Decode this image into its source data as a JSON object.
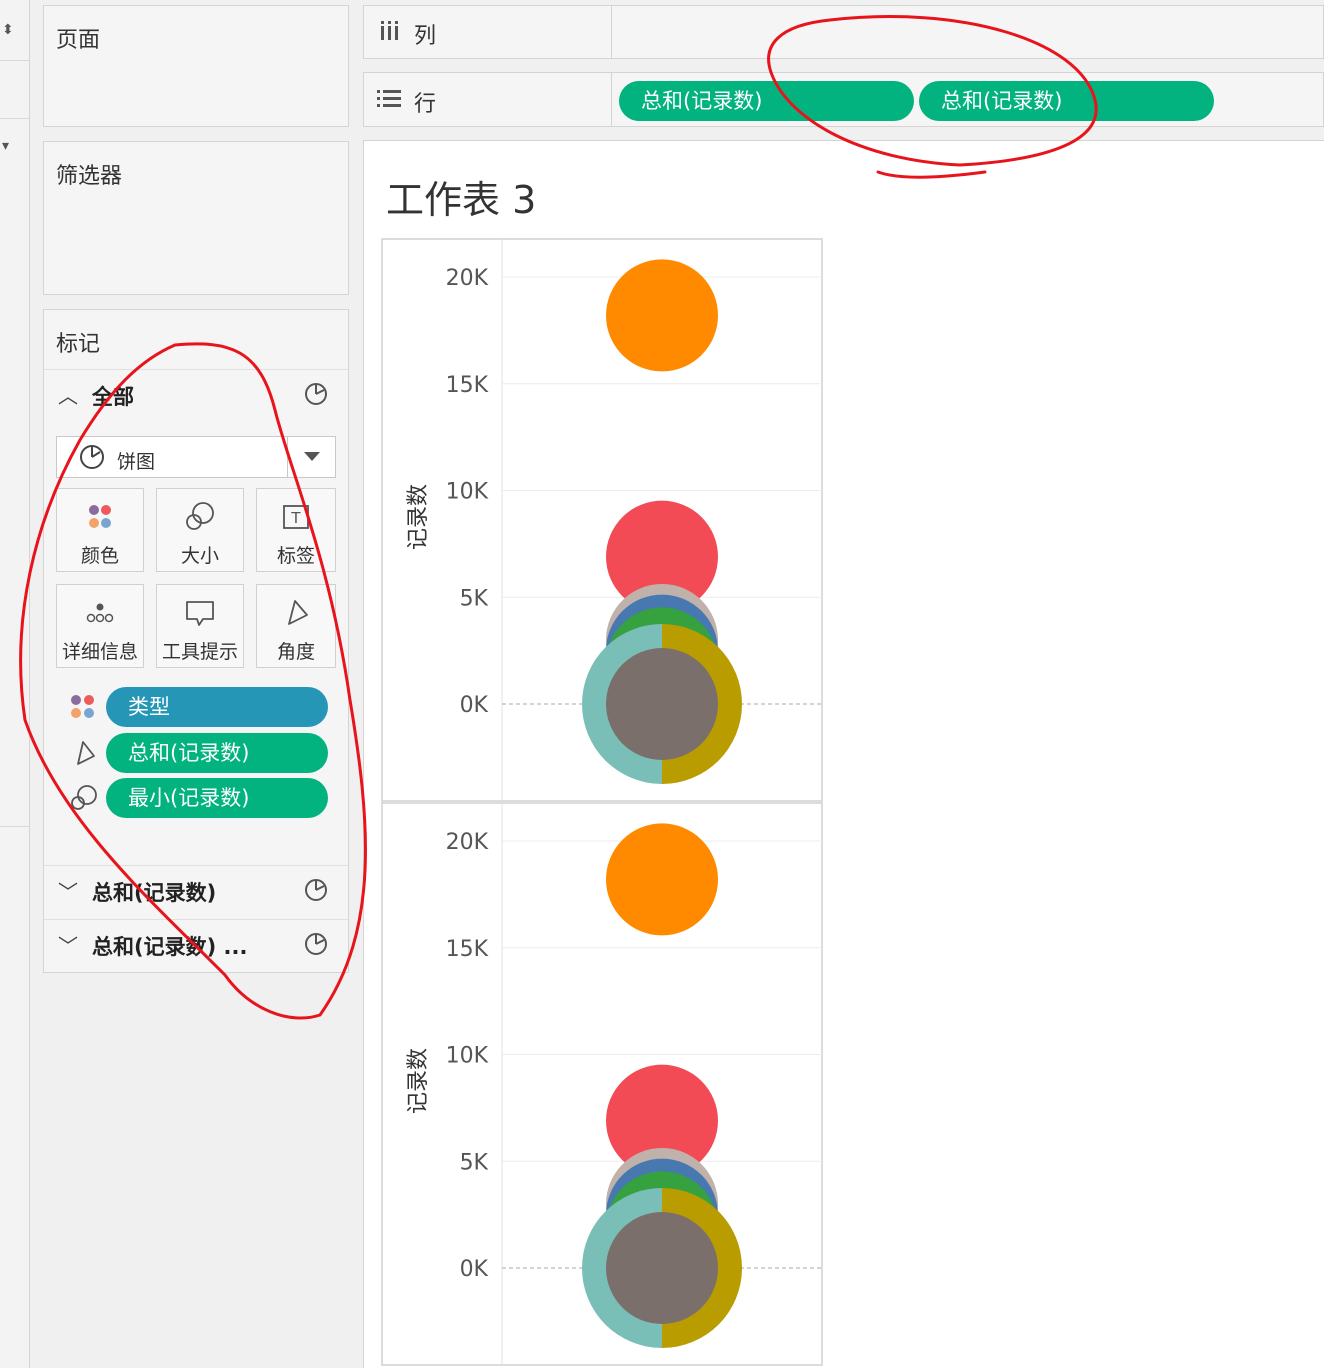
{
  "panels": {
    "pages_title": "页面",
    "filters_title": "筛选器",
    "marks_title": "标记"
  },
  "shelves": {
    "columns_label": "列",
    "rows_label": "行",
    "row_pills": [
      "总和(记录数)",
      "总和(记录数)"
    ]
  },
  "marks": {
    "all_label": "全部",
    "mark_type": "饼图",
    "buttons": [
      "颜色",
      "大小",
      "标签",
      "详细信息",
      "工具提示",
      "角度"
    ],
    "fields": [
      "类型",
      "总和(记录数)",
      "最小(记录数)"
    ],
    "sub_rows": [
      "总和(记录数)",
      "总和(记录数) ..."
    ]
  },
  "sheet": {
    "title": "工作表 3"
  },
  "colors": {
    "green_pill": "#02b37f",
    "blue_pill": "#2596b5",
    "annotation": "#e8141c"
  },
  "chart_data": [
    {
      "type": "scatter",
      "ylabel": "记录数",
      "xlabel": "",
      "ylim": [
        -3000,
        21000
      ],
      "ytick_labels": [
        "20K",
        "15K",
        "10K",
        "5K",
        "0K"
      ],
      "yticks": [
        20000,
        15000,
        10000,
        5000,
        0
      ],
      "grid": true,
      "marks": [
        {
          "y": 18200,
          "color": "#ff8a00"
        },
        {
          "y": 6900,
          "color": "#f24b55"
        },
        {
          "y": 3000,
          "color": "#c0b2ab"
        },
        {
          "y": 2500,
          "color": "#4779b0"
        },
        {
          "y": 1900,
          "color": "#35a13f"
        },
        {
          "y": 0,
          "color": "#79bfb7",
          "color2": "#b99c00"
        },
        {
          "y": 0,
          "color": "#7b6f6b"
        }
      ]
    },
    {
      "type": "scatter",
      "ylabel": "记录数",
      "xlabel": "",
      "ylim": [
        -3000,
        21000
      ],
      "ytick_labels": [
        "20K",
        "15K",
        "10K",
        "5K",
        "0K"
      ],
      "yticks": [
        20000,
        15000,
        10000,
        5000,
        0
      ],
      "grid": true,
      "marks": [
        {
          "y": 18200,
          "color": "#ff8a00"
        },
        {
          "y": 6900,
          "color": "#f24b55"
        },
        {
          "y": 3000,
          "color": "#c0b2ab"
        },
        {
          "y": 2500,
          "color": "#4779b0"
        },
        {
          "y": 1900,
          "color": "#35a13f"
        },
        {
          "y": 0,
          "color": "#79bfb7",
          "color2": "#b99c00"
        },
        {
          "y": 0,
          "color": "#7b6f6b"
        }
      ]
    }
  ]
}
